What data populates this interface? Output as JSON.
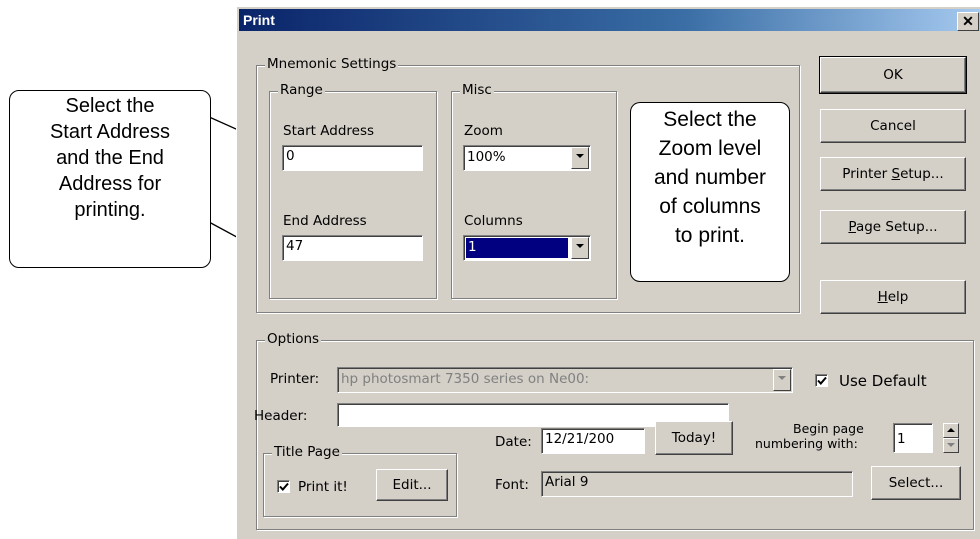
{
  "dialog": {
    "title": "Print",
    "close_glyph": "✕"
  },
  "mnemonic": {
    "group_label": "Mnemonic Settings",
    "range": {
      "label": "Range",
      "start_label": "Start Address",
      "start_value": "0",
      "end_label": "End Address",
      "end_value": "47"
    },
    "misc": {
      "label": "Misc",
      "zoom_label": "Zoom",
      "zoom_value": "100%",
      "columns_label": "Columns",
      "columns_value": "1"
    }
  },
  "buttons": {
    "ok": "OK",
    "cancel": "Cancel",
    "printer_setup_pre": "Printer ",
    "printer_setup_u": "S",
    "printer_setup_post": "etup...",
    "page_setup_u": "P",
    "page_setup_post": "age Setup...",
    "help_u": "H",
    "help_post": "elp"
  },
  "options": {
    "group_label": "Options",
    "printer_label": "Printer:",
    "printer_value": "hp photosmart 7350 series on Ne00:",
    "use_default_label": "Use Default",
    "use_default_checked": true,
    "header_label": "Header:",
    "header_value": "",
    "begin_page_line1": "Begin page",
    "begin_page_line2": "numbering with:",
    "begin_page_value": "1",
    "title_page": {
      "label": "Title Page",
      "print_it_label": "Print it!",
      "print_it_checked": true,
      "edit_button": "Edit..."
    },
    "date_label": "Date:",
    "date_value": "12/21/200",
    "today_button": "Today!",
    "font_label": "Font:",
    "font_value": "Arial 9",
    "select_button": "Select..."
  },
  "callouts": {
    "left": [
      "Select the",
      "Start Address",
      "and the End",
      "Address for",
      "printing."
    ],
    "right": [
      "Select the",
      "Zoom level",
      "and number",
      "of columns",
      "to print."
    ]
  },
  "icons": {
    "close": "close-icon",
    "dropdown": "chevron-down-icon",
    "check": "checkmark-icon",
    "spinner_up": "spin-up-icon",
    "spinner_down": "spin-down-icon"
  }
}
